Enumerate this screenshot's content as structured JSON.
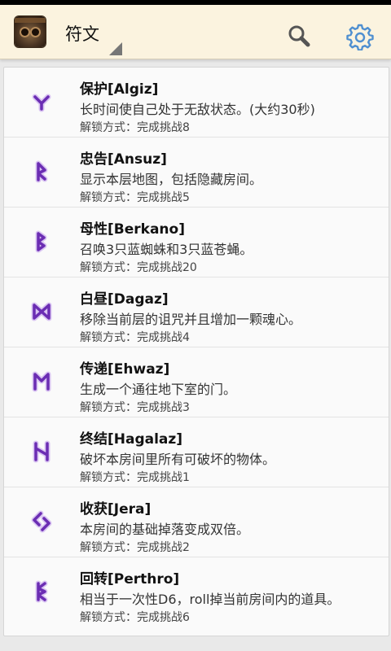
{
  "header": {
    "title": "符文",
    "app_icon": "app-icon-face",
    "search_icon": "search-icon",
    "settings_icon": "gear-icon"
  },
  "colors": {
    "rune": "#6b2db3",
    "rune_glow": "#d9c4f2",
    "actionbar": "#fbf3df"
  },
  "runes": [
    {
      "name": "保护[Algiz]",
      "desc": "长时间使自己处于无敌状态。(大约30秒)",
      "unlock": "解锁方式：完成挑战8",
      "icon": "algiz-rune-icon"
    },
    {
      "name": "忠告[Ansuz]",
      "desc": "显示本层地图，包括隐藏房间。",
      "unlock": "解锁方式：完成挑战5",
      "icon": "ansuz-rune-icon"
    },
    {
      "name": "母性[Berkano]",
      "desc": "召唤3只蓝蜘蛛和3只蓝苍蝇。",
      "unlock": "解锁方式：完成挑战20",
      "icon": "berkano-rune-icon"
    },
    {
      "name": "白昼[Dagaz]",
      "desc": "移除当前层的诅咒并且增加一颗魂心。",
      "unlock": "解锁方式：完成挑战4",
      "icon": "dagaz-rune-icon"
    },
    {
      "name": "传递[Ehwaz]",
      "desc": "生成一个通往地下室的门。",
      "unlock": "解锁方式：完成挑战3",
      "icon": "ehwaz-rune-icon"
    },
    {
      "name": "终结[Hagalaz]",
      "desc": "破坏本房间里所有可破坏的物体。",
      "unlock": "解锁方式：完成挑战1",
      "icon": "hagalaz-rune-icon"
    },
    {
      "name": "收获[Jera]",
      "desc": "本房间的基础掉落变成双倍。",
      "unlock": "解锁方式：完成挑战2",
      "icon": "jera-rune-icon"
    },
    {
      "name": "回转[Perthro]",
      "desc": "相当于一次性D6，roll掉当前房间内的道具。",
      "unlock": "解锁方式：完成挑战6",
      "icon": "perthro-rune-icon"
    }
  ]
}
